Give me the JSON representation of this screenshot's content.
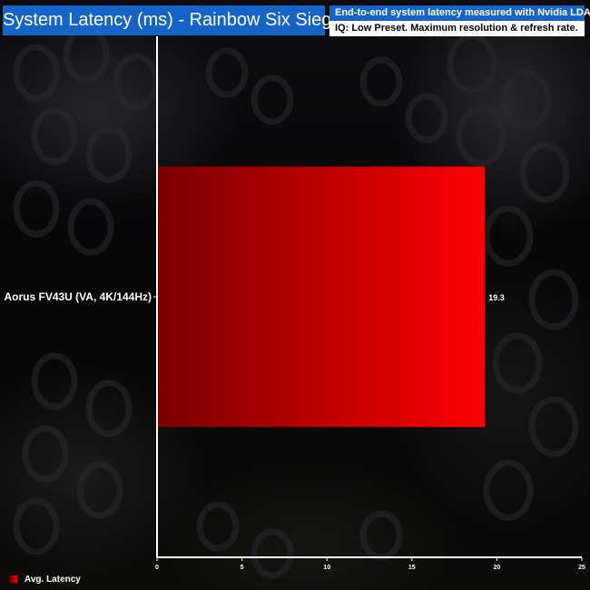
{
  "header": {
    "title": "System Latency (ms) - Rainbow Six Siege",
    "note_1": "End-to-end system latency measured with Nvidia LDAT.",
    "note_2": "IQ: Low Preset. Maximum resolution & refresh rate."
  },
  "colors": {
    "title_bg": "#1565c8",
    "bar_dark": "#7a0000",
    "bar_light": "#ff0000",
    "axis": "#ffffff",
    "text": "#ffffff"
  },
  "legend": {
    "label": "Avg. Latency",
    "position": "bottom-left"
  },
  "chart_data": {
    "type": "bar",
    "orientation": "horizontal",
    "title": "System Latency (ms) - Rainbow Six Siege",
    "categories": [
      "Aorus FV43U (VA, 4K/144Hz)"
    ],
    "series": [
      {
        "name": "Avg. Latency",
        "values": [
          19.3
        ]
      }
    ],
    "data_labels": [
      "19.3"
    ],
    "xlim": [
      0,
      25
    ],
    "xticks": [
      0,
      5,
      10,
      15,
      20,
      25
    ],
    "xlabel": "",
    "ylabel": "",
    "grid": false,
    "legend": "bottom-left"
  }
}
